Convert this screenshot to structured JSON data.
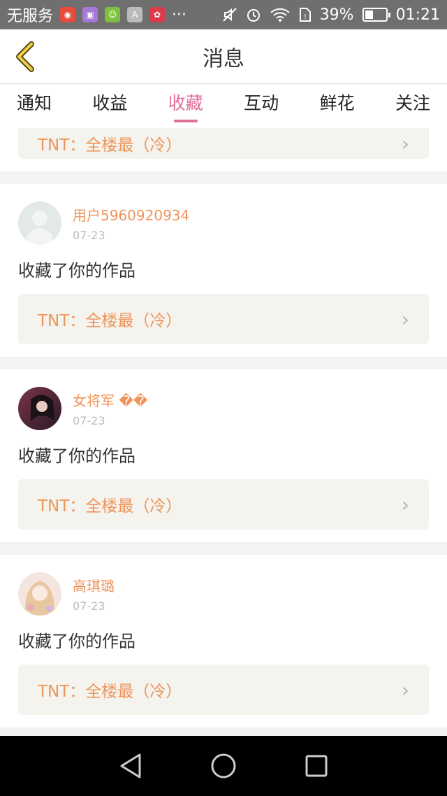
{
  "status_bar": {
    "carrier": "无服务",
    "battery_text": "39%",
    "battery_level": 0.39,
    "time": "01:21",
    "more": "···",
    "icons": [
      "weibo-icon",
      "gallery-icon",
      "wechat-icon",
      "a-icon",
      "huawei-icon",
      "mute-icon",
      "alarm-icon",
      "wifi-icon",
      "sim-icon",
      "battery-icon"
    ]
  },
  "header": {
    "title": "消息"
  },
  "tabs": [
    {
      "label": "通知"
    },
    {
      "label": "收益"
    },
    {
      "label": "收藏",
      "active": true
    },
    {
      "label": "互动"
    },
    {
      "label": "鲜花"
    },
    {
      "label": "关注"
    }
  ],
  "feed": [
    {
      "partial": true,
      "work_title": "TNT：全楼最（冷）"
    },
    {
      "user": "用户5960920934",
      "date": "07-23",
      "action": "收藏了你的作品",
      "work_title": "TNT：全楼最（冷）",
      "avatar": "default-avatar"
    },
    {
      "user": "女将军 ��",
      "date": "07-23",
      "action": "收藏了你的作品",
      "work_title": "TNT：全楼最（冷）",
      "avatar": "photo-avatar-dark"
    },
    {
      "user": "高琪璐",
      "date": "07-23",
      "action": "收藏了你的作品",
      "work_title": "TNT：全楼最（冷）",
      "avatar": "photo-avatar-light"
    }
  ],
  "colors": {
    "accent": "#e06e9b",
    "username": "#f0935a",
    "work_title": "#ee955a",
    "work_bg": "#f4f3ee"
  }
}
